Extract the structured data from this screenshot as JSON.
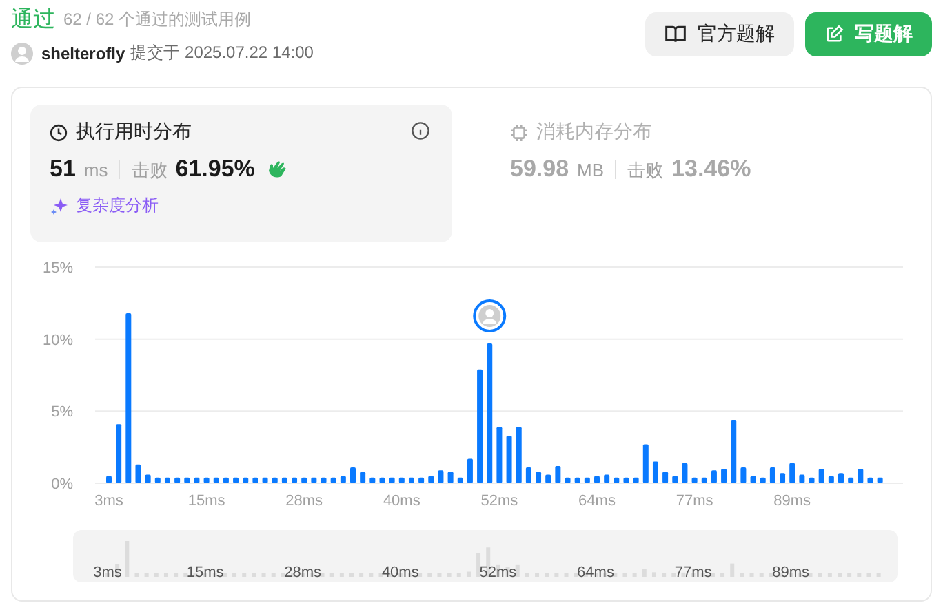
{
  "header": {
    "status": "通过",
    "tests": "62 / 62 个通过的测试用例",
    "user": "shelterofly",
    "submitted": "提交于 2025.07.22 14:00",
    "buttons": [
      {
        "kind": "secondary",
        "label": "官方题解"
      },
      {
        "kind": "primary",
        "label": "写题解"
      }
    ]
  },
  "tabs": [
    {
      "kind": "time",
      "title": "执行用时分布",
      "selected": true,
      "value": "51",
      "unit": "ms",
      "beats_label": "击败",
      "beats": "61.95%",
      "link": "复杂度分析"
    },
    {
      "kind": "memory",
      "title": "消耗内存分布",
      "selected": false,
      "value": "59.98",
      "unit": "MB",
      "beats_label": "击败",
      "beats": "13.46%"
    }
  ],
  "chart_data": {
    "type": "bar",
    "categories": [
      "3ms",
      null,
      null,
      null,
      null,
      null,
      null,
      null,
      null,
      null,
      "15ms",
      null,
      null,
      null,
      null,
      null,
      null,
      null,
      null,
      null,
      "28ms",
      null,
      null,
      null,
      null,
      null,
      null,
      null,
      null,
      null,
      "40ms",
      null,
      null,
      null,
      null,
      null,
      null,
      null,
      null,
      null,
      "52ms",
      null,
      null,
      null,
      null,
      null,
      null,
      null,
      null,
      null,
      "64ms",
      null,
      null,
      null,
      null,
      null,
      null,
      null,
      null,
      null,
      "77ms",
      null,
      null,
      null,
      null,
      null,
      null,
      null,
      null,
      null,
      "89ms",
      null,
      null,
      null,
      null,
      null,
      null,
      null,
      null,
      null
    ],
    "series": [
      {
        "color": "#0a7aff",
        "values": [
          0.5,
          4.1,
          11.8,
          1.3,
          0.6,
          0.4,
          0.4,
          0.4,
          0.4,
          0.4,
          0.4,
          0.4,
          0.4,
          0.4,
          0.4,
          0.4,
          0.4,
          0.4,
          0.4,
          0.4,
          0.4,
          0.4,
          0.4,
          0.4,
          0.5,
          1.1,
          0.8,
          0.4,
          0.4,
          0.4,
          0.4,
          0.4,
          0.4,
          0.5,
          0.9,
          0.8,
          0.4,
          1.7,
          7.9,
          9.7,
          3.9,
          3.3,
          3.9,
          1.1,
          0.8,
          0.6,
          1.2,
          0.4,
          0.4,
          0.4,
          0.5,
          0.6,
          0.4,
          0.4,
          0.4,
          2.7,
          1.5,
          0.8,
          0.5,
          1.4,
          0.4,
          0.4,
          0.9,
          1.0,
          4.4,
          1.1,
          0.5,
          0.4,
          1.1,
          0.7,
          1.4,
          0.6,
          0.4,
          1.0,
          0.5,
          0.7,
          0.4,
          1.0,
          0.4,
          0.4
        ]
      }
    ],
    "ylim": [
      0,
      15
    ],
    "yticks": [
      {
        "value": 0,
        "label": "0%"
      },
      {
        "value": 5,
        "label": "5%"
      },
      {
        "value": 10,
        "label": "10%"
      },
      {
        "value": 15,
        "label": "15%"
      }
    ]
  },
  "overview": {
    "labels": [
      "3ms",
      "15ms",
      "28ms",
      "40ms",
      "52ms",
      "64ms",
      "77ms",
      "89ms"
    ]
  }
}
